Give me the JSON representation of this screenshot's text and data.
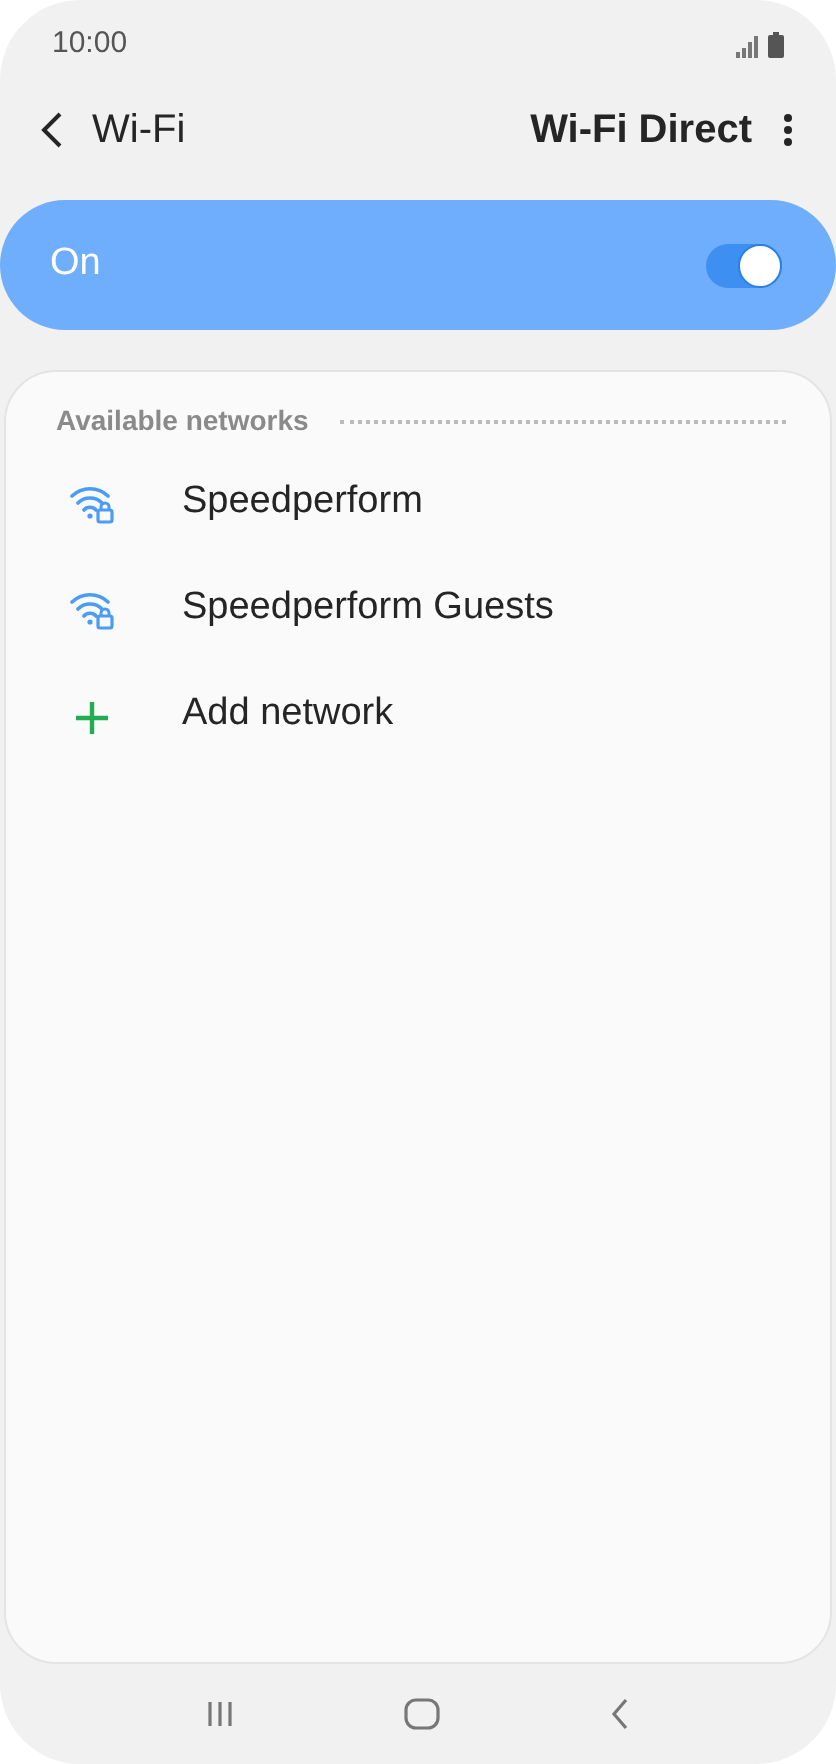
{
  "status_bar": {
    "time": "10:00"
  },
  "header": {
    "title": "Wi-Fi",
    "action": "Wi-Fi Direct"
  },
  "master_switch": {
    "label": "On",
    "on": true
  },
  "networks": {
    "heading": "Available networks",
    "items": [
      {
        "kind": "wifi",
        "label": "Speedperform"
      },
      {
        "kind": "wifi",
        "label": "Speedperform Guests"
      },
      {
        "kind": "add",
        "label": "Add network"
      }
    ]
  }
}
